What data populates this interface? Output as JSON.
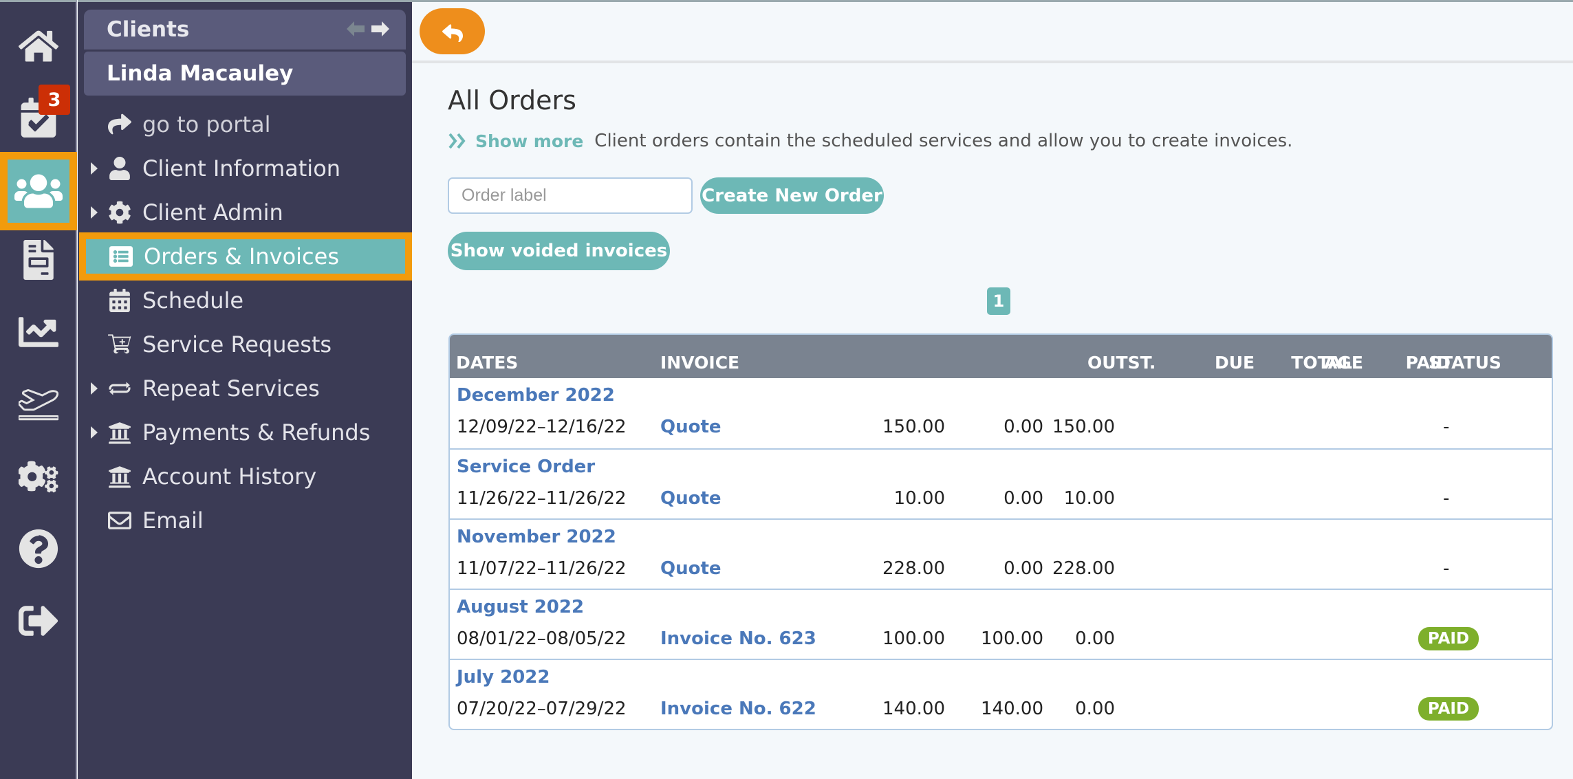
{
  "rail": {
    "items": [
      {
        "name": "home",
        "icon": "home-icon"
      },
      {
        "name": "tasks",
        "icon": "calendar-check-icon",
        "badge": "3"
      },
      {
        "name": "clients",
        "icon": "users-icon",
        "active": true
      },
      {
        "name": "documents",
        "icon": "file-invoice-icon"
      },
      {
        "name": "reports",
        "icon": "chart-line-icon"
      },
      {
        "name": "departures",
        "icon": "plane-departure-icon"
      },
      {
        "name": "settings",
        "icon": "gears-icon"
      },
      {
        "name": "help",
        "icon": "question-circle-icon"
      },
      {
        "name": "logout",
        "icon": "sign-out-icon"
      }
    ]
  },
  "sidebar": {
    "section_title": "Clients",
    "client_name": "Linda Macauley",
    "items": [
      {
        "label": "go to portal",
        "icon": "share-arrow-icon",
        "expandable": false
      },
      {
        "label": "Client Information",
        "icon": "user-icon",
        "expandable": true
      },
      {
        "label": "Client Admin",
        "icon": "gear-icon",
        "expandable": true
      },
      {
        "label": "Orders & Invoices",
        "icon": "list-alt-icon",
        "expandable": false,
        "active": true
      },
      {
        "label": "Schedule",
        "icon": "calendar-icon",
        "expandable": false
      },
      {
        "label": "Service Requests",
        "icon": "cart-plus-icon",
        "expandable": false
      },
      {
        "label": "Repeat Services",
        "icon": "repeat-icon",
        "expandable": true
      },
      {
        "label": "Payments & Refunds",
        "icon": "bank-icon",
        "expandable": true
      },
      {
        "label": "Account History",
        "icon": "bank-icon",
        "expandable": false
      },
      {
        "label": "Email",
        "icon": "envelope-icon",
        "expandable": false
      }
    ]
  },
  "main": {
    "title": "All Orders",
    "show_more": "Show more",
    "description": "Client orders contain the scheduled services and allow you to create invoices.",
    "order_input": {
      "placeholder": "Order label",
      "value": ""
    },
    "create_button": "Create New Order",
    "voided_button": "Show voided invoices",
    "current_page": "1",
    "table": {
      "headers": {
        "dates": "DATES",
        "invoice": "INVOICE",
        "total": "TOTAL",
        "paid": "PAID",
        "outst": "OUTST.",
        "due": "DUE",
        "age": "AGE",
        "status": "STATUS"
      },
      "rows": [
        {
          "group": "December 2022",
          "dates": "12/09/22–12/16/22",
          "invoice": "Quote",
          "total": "150.00",
          "paid": "0.00",
          "outst": "150.00",
          "due": "",
          "age": "",
          "status": "-"
        },
        {
          "group": "Service Order",
          "dates": "11/26/22–11/26/22",
          "invoice": "Quote",
          "total": "10.00",
          "paid": "0.00",
          "outst": "10.00",
          "due": "",
          "age": "",
          "status": "-"
        },
        {
          "group": "November 2022",
          "dates": "11/07/22–11/26/22",
          "invoice": "Quote",
          "total": "228.00",
          "paid": "0.00",
          "outst": "228.00",
          "due": "",
          "age": "",
          "status": "-"
        },
        {
          "group": "August 2022",
          "dates": "08/01/22–08/05/22",
          "invoice": "Invoice No. 623",
          "total": "100.00",
          "paid": "100.00",
          "outst": "0.00",
          "due": "",
          "age": "",
          "status": "PAID"
        },
        {
          "group": "July 2022",
          "dates": "07/20/22–07/29/22",
          "invoice": "Invoice No. 622",
          "total": "140.00",
          "paid": "140.00",
          "outst": "0.00",
          "due": "",
          "age": "",
          "status": "PAID"
        }
      ]
    }
  },
  "colors": {
    "rail_bg": "#3b3b55",
    "accent_teal": "#6db8b6",
    "highlight_orange": "#f29b0c",
    "back_button": "#ee8e1c",
    "badge_red": "#cc2f06",
    "paid_green": "#7eaf2c",
    "link_blue": "#4a78b9",
    "table_header": "#7a8390"
  }
}
